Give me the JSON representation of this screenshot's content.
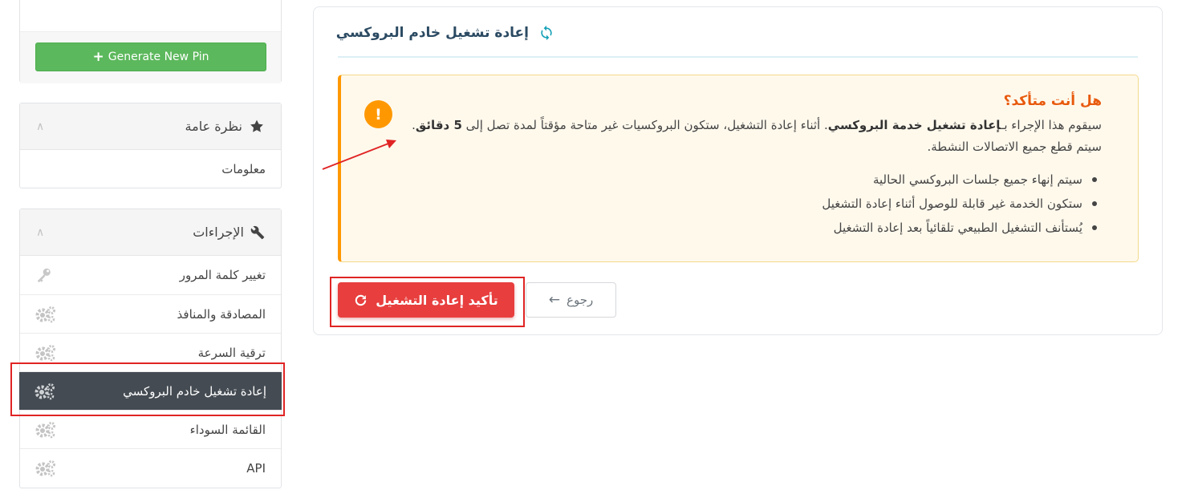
{
  "sidebar": {
    "generate_pin_label": "Generate New Pin",
    "overview": {
      "title": "نظرة عامة",
      "items": [
        {
          "label": "معلومات"
        }
      ]
    },
    "actions": {
      "title": "الإجراءات",
      "items": [
        {
          "label": "تغيير كلمة المرور"
        },
        {
          "label": "المصادقة والمنافذ"
        },
        {
          "label": "ترقية السرعة"
        },
        {
          "label": "إعادة تشغيل خادم البروكسي"
        },
        {
          "label": "القائمة السوداء"
        },
        {
          "label": "API"
        }
      ]
    }
  },
  "main": {
    "title": "إعادة تشغيل خادم البروكسي",
    "alert": {
      "title": "هل أنت متأكد؟",
      "para_1": "سيقوم هذا الإجراء بـ",
      "para_bold_1": "إعادة تشغيل خدمة البروكسي",
      "para_2": ". أثناء إعادة التشغيل، ستكون البروكسيات غير متاحة مؤقتاً لمدة تصل إلى ",
      "para_bold_2": "5 دقائق",
      "para_3": ". سيتم قطع جميع الاتصالات النشطة.",
      "bullets": [
        "سيتم إنهاء جميع جلسات البروكسي الحالية",
        "ستكون الخدمة غير قابلة للوصول أثناء إعادة التشغيل",
        "يُستأنف التشغيل الطبيعي تلقائياً بعد إعادة التشغيل"
      ]
    },
    "confirm_label": "تأكيد إعادة التشغيل",
    "back_label": "رجوع"
  },
  "colors": {
    "accent_green": "#5cb85c",
    "active_item": "#444b52",
    "confirm_red": "#e83e3e",
    "warning_orange": "#ff9800",
    "highlight_red": "#e02424"
  }
}
